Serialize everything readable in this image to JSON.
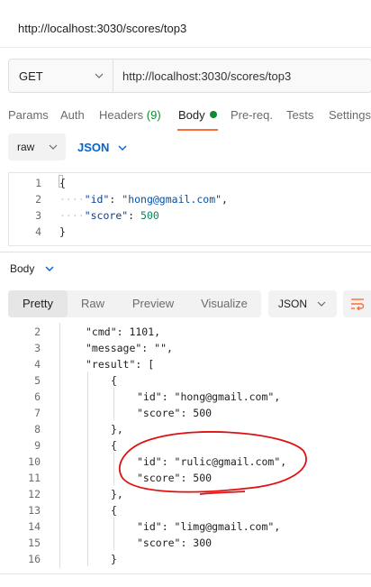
{
  "request": {
    "title": "http://localhost:3030/scores/top3",
    "method": "GET",
    "url": "http://localhost:3030/scores/top3"
  },
  "tabs": [
    {
      "label": "Params"
    },
    {
      "label": "Auth"
    },
    {
      "label": "Headers",
      "count": "(9)"
    },
    {
      "label": "Body",
      "active": true
    },
    {
      "label": "Pre-req."
    },
    {
      "label": "Tests"
    },
    {
      "label": "Settings"
    }
  ],
  "body_editor": {
    "type": "raw",
    "language": "JSON",
    "lines": [
      {
        "num": "1",
        "text": "{"
      },
      {
        "num": "2",
        "key": "\"id\"",
        "value": "\"hong@gmail.com\"",
        "trail": ","
      },
      {
        "num": "3",
        "key": "\"score\"",
        "value": "500",
        "trail": ""
      },
      {
        "num": "4",
        "text": "}"
      }
    ]
  },
  "response": {
    "label": "Body",
    "view_tabs": [
      "Pretty",
      "Raw",
      "Preview",
      "Visualize"
    ],
    "active_view": "Pretty",
    "format": "JSON",
    "lines": [
      {
        "num": "2",
        "text": "\"cmd\": 1101,"
      },
      {
        "num": "3",
        "text": "\"message\": \"\","
      },
      {
        "num": "4",
        "text": "\"result\": ["
      },
      {
        "num": "5",
        "text": "{"
      },
      {
        "num": "6",
        "text": "\"id\": \"hong@gmail.com\","
      },
      {
        "num": "7",
        "text": "\"score\": 500"
      },
      {
        "num": "8",
        "text": "},"
      },
      {
        "num": "9",
        "text": "{"
      },
      {
        "num": "10",
        "text": "\"id\": \"rulic@gmail.com\","
      },
      {
        "num": "11",
        "text": "\"score\": 500"
      },
      {
        "num": "12",
        "text": "},"
      },
      {
        "num": "13",
        "text": "{"
      },
      {
        "num": "14",
        "text": "\"id\": \"limg@gmail.com\","
      },
      {
        "num": "15",
        "text": "\"score\": 300"
      },
      {
        "num": "16",
        "text": "}"
      }
    ]
  },
  "colors": {
    "accent": "#ff6c37",
    "active_dot": "#0f8a2f",
    "link_blue": "#0265d2",
    "annotation_red": "#e01010"
  },
  "icons": [
    "chevron-down-icon",
    "wrap-lines-icon"
  ]
}
